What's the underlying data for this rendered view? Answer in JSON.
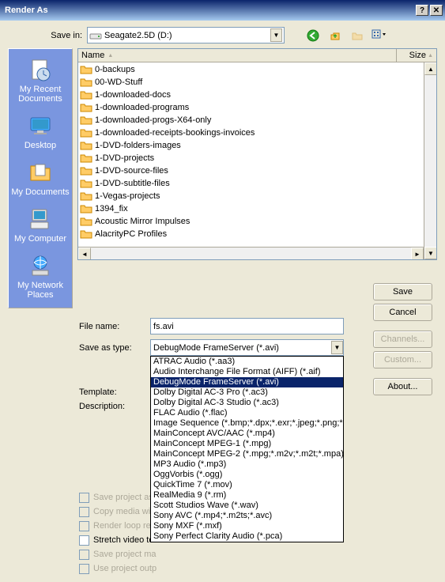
{
  "title": "Render As",
  "save_in_label": "Save in:",
  "save_in_value": "Seagate2.5D (D:)",
  "list_header": {
    "name": "Name",
    "size": "Size"
  },
  "files": [
    "0-backups",
    "00-WD-Stuff",
    "1-downloaded-docs",
    "1-downloaded-programs",
    "1-downloaded-progs-X64-only",
    "1-downloaded-receipts-bookings-invoices",
    "1-DVD-folders-images",
    "1-DVD-projects",
    "1-DVD-source-files",
    "1-DVD-subtitle-files",
    "1-Vegas-projects",
    "1394_fix",
    "Acoustic Mirror Impulses",
    "AlacrityPC Profiles"
  ],
  "file_name_label": "File name:",
  "file_name_value": "fs.avi",
  "save_as_type_label": "Save as type:",
  "save_as_type_value": "DebugMode FrameServer (*.avi)",
  "template_label": "Template:",
  "description_label": "Description:",
  "type_options": [
    "ATRAC Audio (*.aa3)",
    "Audio Interchange File Format (AIFF) (*.aif)",
    "DebugMode FrameServer (*.avi)",
    "Dolby Digital AC-3 Pro (*.ac3)",
    "Dolby Digital AC-3 Studio (*.ac3)",
    "FLAC Audio (*.flac)",
    "Image Sequence (*.bmp;*.dpx;*.exr;*.jpeg;*.png;*.tif",
    "MainConcept AVC/AAC (*.mp4)",
    "MainConcept MPEG-1 (*.mpg)",
    "MainConcept MPEG-2 (*.mpg;*.m2v;*.m2t;*.mpa)",
    "MP3 Audio (*.mp3)",
    "OggVorbis (*.ogg)",
    "QuickTime 7 (*.mov)",
    "RealMedia 9 (*.rm)",
    "Scott Studios Wave (*.wav)",
    "Sony AVC (*.mp4;*.m2ts;*.avc)",
    "Sony MXF (*.mxf)",
    "Sony Perfect Clarity Audio (*.pca)"
  ],
  "type_selected_index": 2,
  "buttons": {
    "save": "Save",
    "cancel": "Cancel",
    "channels": "Channels...",
    "custom": "Custom...",
    "about": "About..."
  },
  "places": [
    "My Recent Documents",
    "Desktop",
    "My Documents",
    "My Computer",
    "My Network Places"
  ],
  "checkboxes": {
    "save_project_as": "Save project as",
    "copy_media": "Copy media with",
    "render_loop": "Render loop reg",
    "stretch_video": "Stretch video to",
    "save_project_ma": "Save project ma",
    "use_project_out": "Use project outp"
  }
}
